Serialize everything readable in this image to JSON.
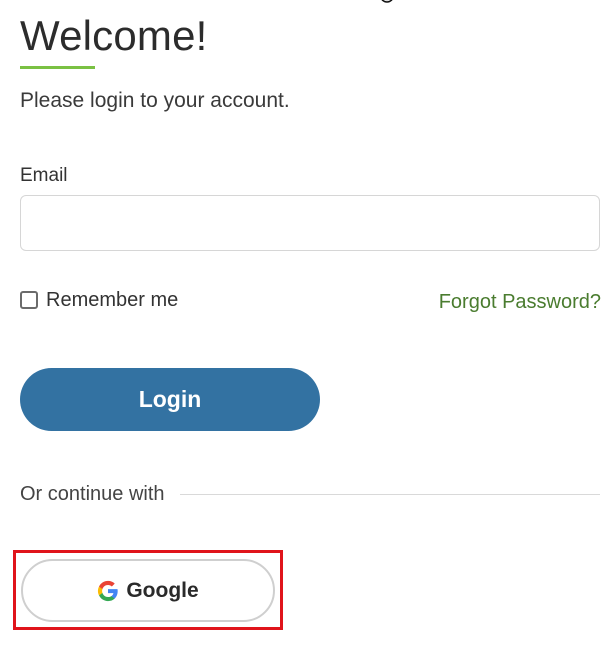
{
  "header": {
    "title": "Welcome!",
    "subtitle": "Please login to your account."
  },
  "form": {
    "email_label": "Email",
    "email_value": "",
    "email_placeholder": "",
    "remember_label": "Remember me",
    "remember_checked": false,
    "forgot_label": "Forgot Password?",
    "login_label": "Login"
  },
  "alternate": {
    "divider_text": "Or continue with",
    "google_label": "Google",
    "google_icon": "google-g-icon",
    "highlighted": true
  },
  "colors": {
    "accent_underline": "#7ac143",
    "login_button": "#3372a2",
    "link": "#4a7c2f",
    "highlight_box": "#e0141b"
  }
}
